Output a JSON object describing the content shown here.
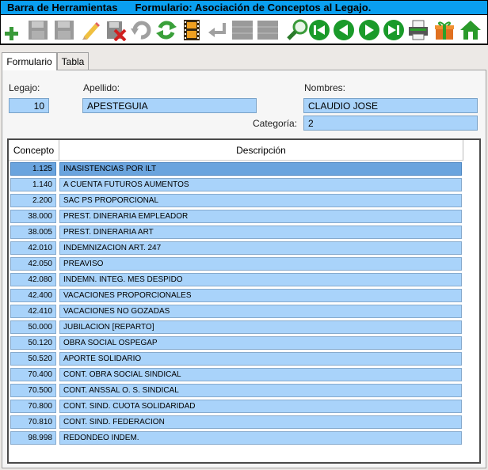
{
  "title": {
    "left": "Barra de Herramientas",
    "right": "Formulario: Asociación de Conceptos al Legajo."
  },
  "toolbar": {
    "icons": [
      "add-icon",
      "save-icon-disabled",
      "save-as-icon-disabled",
      "edit-icon",
      "delete-icon",
      "undo-icon-disabled",
      "refresh-icon",
      "film-icon",
      "enter-icon-disabled",
      "grid-icon-disabled",
      "grid2-icon-disabled",
      "search-icon",
      "first-icon",
      "prev-icon",
      "next-icon",
      "last-icon",
      "print-icon",
      "gift-icon",
      "home-icon"
    ]
  },
  "tabs": [
    {
      "label": "Formulario",
      "active": true
    },
    {
      "label": "Tabla",
      "active": false
    }
  ],
  "form": {
    "legajo_label": "Legajo:",
    "legajo_value": "10",
    "apellido_label": "Apellido:",
    "apellido_value": "APESTEGUIA",
    "nombres_label": "Nombres:",
    "nombres_value": "CLAUDIO JOSE",
    "categoria_label": "Categoría:",
    "categoria_value": "2"
  },
  "grid": {
    "columns": [
      "Concepto",
      "Descripción"
    ],
    "rows": [
      {
        "code": "1.125",
        "desc": "INASISTENCIAS POR ILT"
      },
      {
        "code": "1.140",
        "desc": "A CUENTA FUTUROS AUMENTOS"
      },
      {
        "code": "2.200",
        "desc": "SAC PS PROPORCIONAL"
      },
      {
        "code": "38.000",
        "desc": "PREST. DINERARIA EMPLEADOR"
      },
      {
        "code": "38.005",
        "desc": "PREST. DINERARIA ART"
      },
      {
        "code": "42.010",
        "desc": "INDEMNIZACION ART. 247"
      },
      {
        "code": "42.050",
        "desc": "PREAVISO"
      },
      {
        "code": "42.080",
        "desc": "INDEMN. INTEG. MES DESPIDO"
      },
      {
        "code": "42.400",
        "desc": "VACACIONES PROPORCIONALES"
      },
      {
        "code": "42.410",
        "desc": "VACACIONES NO GOZADAS"
      },
      {
        "code": "50.000",
        "desc": "JUBILACION [REPARTO]"
      },
      {
        "code": "50.120",
        "desc": "OBRA SOCIAL OSPEGAP"
      },
      {
        "code": "50.520",
        "desc": "APORTE SOLIDARIO"
      },
      {
        "code": "70.400",
        "desc": "CONT. OBRA SOCIAL SINDICAL"
      },
      {
        "code": "70.500",
        "desc": "CONT. ANSSAL O. S. SINDICAL"
      },
      {
        "code": "70.800",
        "desc": "CONT. SIND. CUOTA SOLIDARIDAD"
      },
      {
        "code": "70.810",
        "desc": "CONT. SIND. FEDERACION"
      },
      {
        "code": "98.998",
        "desc": "REDONDEO INDEM."
      }
    ],
    "selected_index": 0
  },
  "colors": {
    "titlebar": "#0a9ff0",
    "field": "#a9d3fa",
    "selected_row": "#6aa4de"
  }
}
